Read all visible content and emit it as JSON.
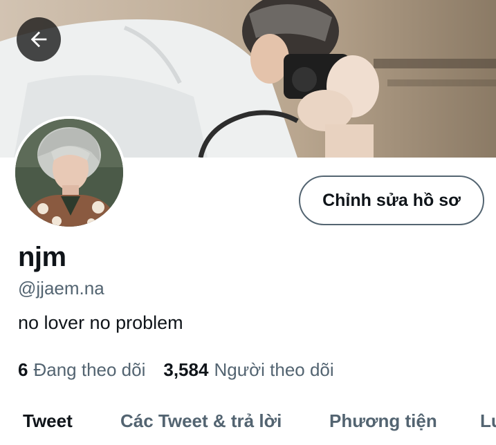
{
  "header": {
    "back_icon": "arrow-left-icon",
    "banner_image": "photographer-with-camera"
  },
  "profile": {
    "avatar_image": "user-avatar-photo",
    "edit_button_label": "Chỉnh sửa hồ sơ",
    "display_name": "njm",
    "handle": "@jjaem.na",
    "bio": "no lover no problem"
  },
  "stats": {
    "following_count": "6",
    "following_label": "Đang theo dõi",
    "followers_count": "3,584",
    "followers_label": "Người theo dõi"
  },
  "tabs": [
    {
      "label": "Tweet",
      "active": true
    },
    {
      "label": "Các Tweet & trả lời",
      "active": false
    },
    {
      "label": "Phương tiện",
      "active": false
    },
    {
      "label": "Lư",
      "active": false
    }
  ],
  "colors": {
    "primary_text": "#0f1419",
    "secondary_text": "#536471",
    "border": "#536471"
  }
}
